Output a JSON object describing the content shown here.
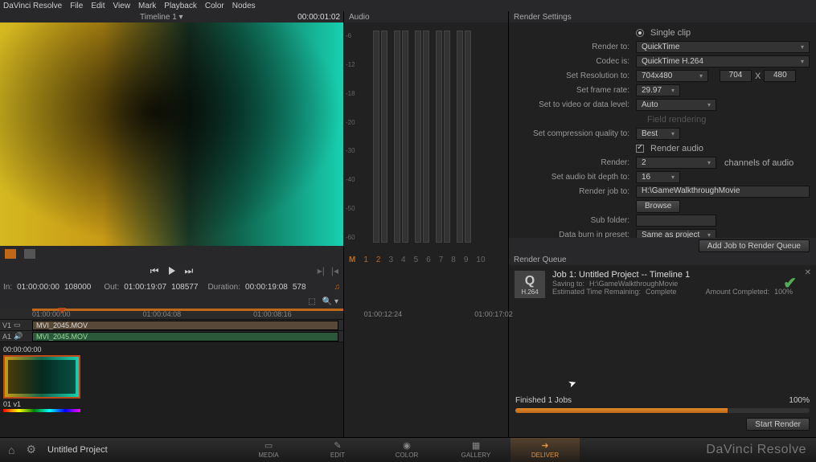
{
  "app": {
    "name": "DaVinci Resolve"
  },
  "menubar": [
    "DaVinci Resolve",
    "File",
    "Edit",
    "View",
    "Mark",
    "Playback",
    "Color",
    "Nodes"
  ],
  "preview": {
    "timeline_name": "Timeline 1 ▾",
    "timecode": "00:00:01:02"
  },
  "transport": {
    "in_label": "In:",
    "in_tc": "01:00:00:00",
    "in_frame": "108000",
    "out_label": "Out:",
    "out_tc": "01:00:19:07",
    "out_frame": "108577",
    "dur_label": "Duration:",
    "dur_tc": "00:00:19:08",
    "dur_frame": "578"
  },
  "timeline": {
    "ruler": [
      "01:00:00:00",
      "01:00:04:08",
      "01:00:08:16",
      "01:00:12:24",
      "01:00:17:02"
    ],
    "v_label": "V1",
    "a_label": "A1",
    "clip_name": "MVI_2045.MOV"
  },
  "bin": {
    "tc": "00:00:00:00",
    "label": "01 v1"
  },
  "audio": {
    "title": "Audio",
    "scale": [
      "-6",
      "-12",
      "-18",
      "-20",
      "-30",
      "-40",
      "-50",
      "-60"
    ],
    "M": "M",
    "channels": [
      "1",
      "2",
      "3",
      "4",
      "5",
      "6",
      "7",
      "8",
      "9",
      "10"
    ]
  },
  "render_settings": {
    "title": "Render Settings",
    "single_clip": "Single clip",
    "rows": {
      "render_to_label": "Render to:",
      "render_to": "QuickTime",
      "codec_label": "Codec is:",
      "codec": "QuickTime H.264",
      "res_label": "Set Resolution to:",
      "res": "704x480",
      "res_w": "704",
      "res_x": "X",
      "res_h": "480",
      "fps_label": "Set frame rate:",
      "fps": "29.97",
      "level_label": "Set to video or data level:",
      "level": "Auto",
      "field_label": "Field rendering",
      "quality_label": "Set compression quality to:",
      "quality": "Best",
      "render_audio": "Render audio",
      "render_ch_label": "Render:",
      "render_ch": "2",
      "channels_of": "channels of audio",
      "bitdepth_label": "Set audio bit depth to:",
      "bitdepth": "16",
      "job_to_label": "Render job to:",
      "job_to": "H:\\GameWalkthroughMovie",
      "browse": "Browse",
      "subfolder_label": "Sub folder:",
      "subfolder": "",
      "burn_label": "Data burn in preset:",
      "burn": "Same as project"
    },
    "add_job": "Add Job to Render Queue"
  },
  "render_queue": {
    "title": "Render Queue",
    "codec_badge": "H.264",
    "job_title": "Job 1: Untitled Project -- Timeline 1",
    "saving_label": "Saving to:",
    "saving": "H:\\GameWalkthroughMovie",
    "etr_label": "Estimated Time Remaining:",
    "etr": "Complete",
    "amt_label": "Amount Completed:",
    "amt": "100%",
    "finished": "Finished 1 Jobs",
    "pct": "100%",
    "start": "Start Render"
  },
  "bottom": {
    "project": "Untitled Project",
    "tabs": [
      {
        "ic": "▭",
        "t": "MEDIA"
      },
      {
        "ic": "✎",
        "t": "EDIT"
      },
      {
        "ic": "◉",
        "t": "COLOR"
      },
      {
        "ic": "▦",
        "t": "GALLERY"
      },
      {
        "ic": "➜",
        "t": "DELIVER"
      }
    ],
    "brand": "DaVinci Resolve"
  }
}
